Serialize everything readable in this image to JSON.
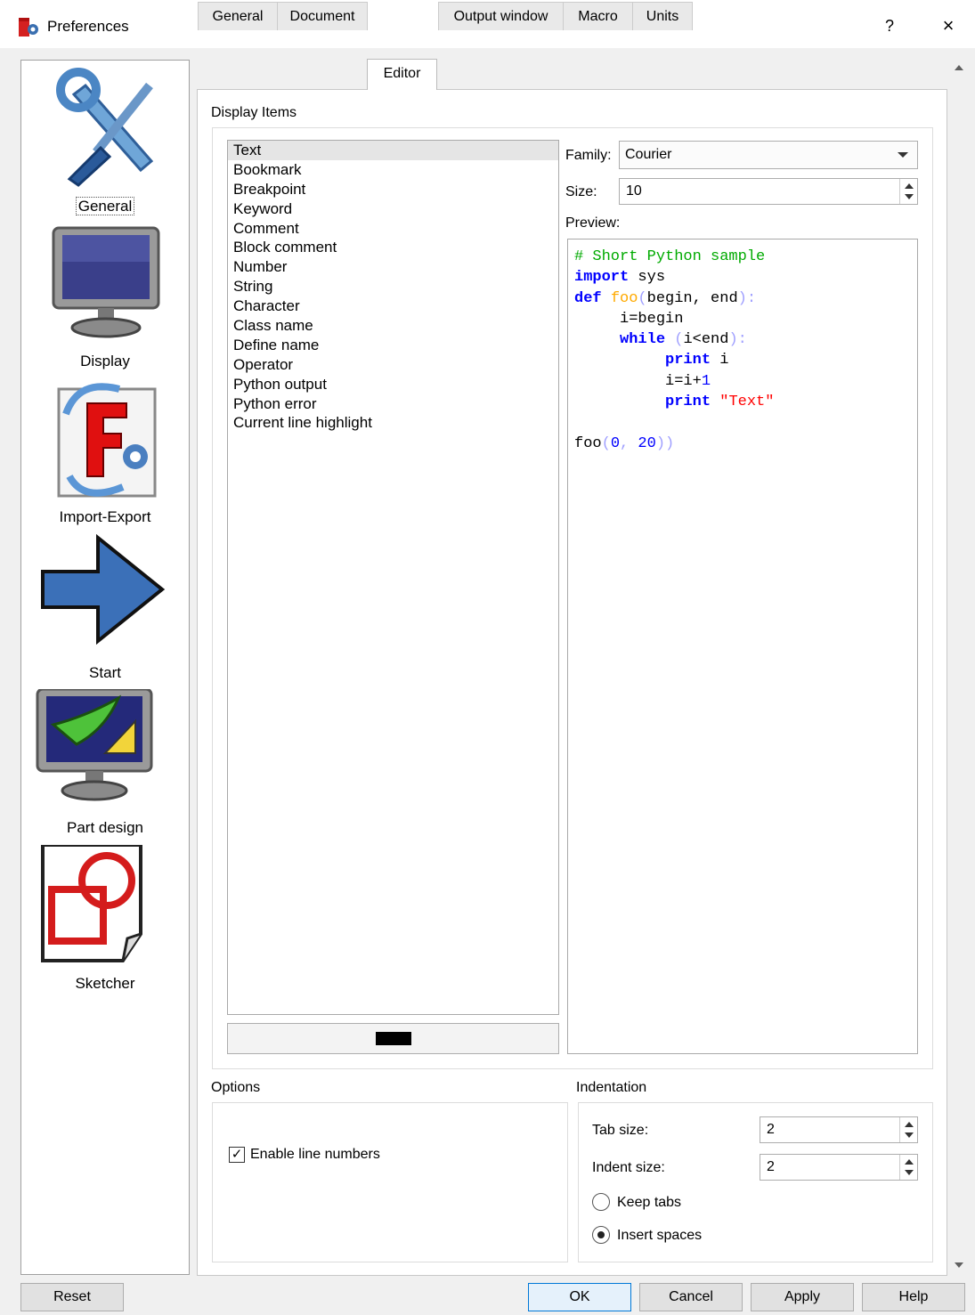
{
  "window": {
    "title": "Preferences",
    "help_label": "?",
    "close_label": "×"
  },
  "sidebar": {
    "items": [
      {
        "label": "General",
        "icon": "general-tools-icon"
      },
      {
        "label": "Display",
        "icon": "monitor-icon"
      },
      {
        "label": "Import-Export",
        "icon": "import-export-icon"
      },
      {
        "label": "Start",
        "icon": "arrow-right-icon"
      },
      {
        "label": "Part design",
        "icon": "part-design-icon"
      },
      {
        "label": "Sketcher",
        "icon": "sketcher-icon"
      }
    ],
    "selected": "General"
  },
  "tabs": [
    {
      "label": "General"
    },
    {
      "label": "Document"
    },
    {
      "label": "Editor"
    },
    {
      "label": "Output window"
    },
    {
      "label": "Macro"
    },
    {
      "label": "Units"
    }
  ],
  "active_tab": "Editor",
  "display_items": {
    "section_label": "Display Items",
    "items": [
      "Text",
      "Bookmark",
      "Breakpoint",
      "Keyword",
      "Comment",
      "Block comment",
      "Number",
      "String",
      "Character",
      "Class name",
      "Define name",
      "Operator",
      "Python output",
      "Python error",
      "Current line highlight"
    ],
    "selected": "Text",
    "selected_color": "#000000"
  },
  "font": {
    "family_label": "Family:",
    "family_value": "Courier",
    "size_label": "Size:",
    "size_value": "10",
    "preview_label": "Preview:"
  },
  "preview_code": {
    "line1": "# Short Python sample",
    "line2_kw": "import",
    "line2_rest": " sys",
    "line3_kw": "def",
    "line3_fn": "foo",
    "line3_rest": "begin, end",
    "line4": "i=begin",
    "line5_kw": "while",
    "line5_rest": "i<end",
    "line6_kw": "print",
    "line6_rest": " i",
    "line7_a": "i=i+",
    "line7_num": "1",
    "line8_kw": "print",
    "line8_str": "\"Text\"",
    "line10_fn": "foo",
    "line10_a": "0",
    "line10_b": "20",
    "colors": {
      "comment": "#00aa00",
      "keyword": "#0000ff",
      "define": "#ffaa00",
      "number": "#0000ff",
      "string": "#ff0000",
      "operator": "#a0a0ff",
      "text": "#000000"
    }
  },
  "options": {
    "section_label": "Options",
    "enable_line_numbers_label": "Enable line numbers",
    "enable_line_numbers_checked": true,
    "check_mark": "✓"
  },
  "indentation": {
    "section_label": "Indentation",
    "tab_size_label": "Tab size:",
    "tab_size_value": "2",
    "indent_size_label": "Indent size:",
    "indent_size_value": "2",
    "keep_tabs_label": "Keep tabs",
    "insert_spaces_label": "Insert spaces",
    "selected_mode": "Insert spaces"
  },
  "buttons": {
    "reset": "Reset",
    "ok": "OK",
    "cancel": "Cancel",
    "apply": "Apply",
    "help": "Help"
  }
}
